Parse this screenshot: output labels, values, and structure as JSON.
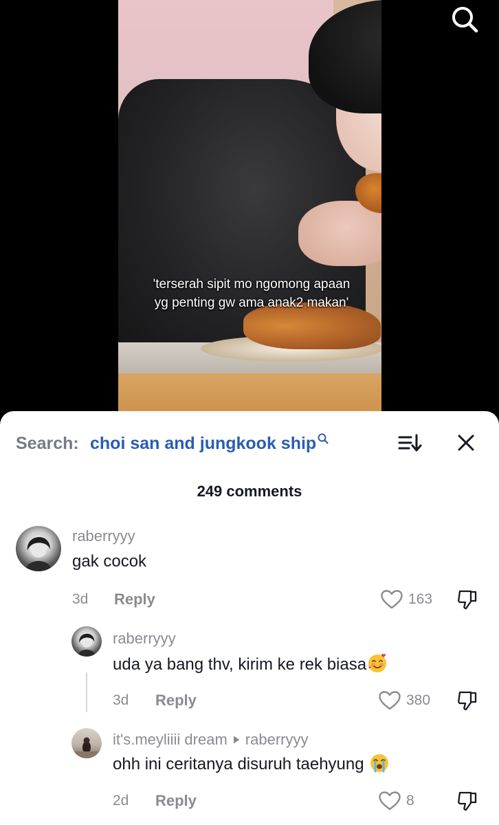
{
  "video": {
    "caption_line1": "'terserah sipit mo ngomong apaan",
    "caption_line2": "yg penting gw ama anak2 makan'"
  },
  "header": {
    "search_label": "Search:",
    "search_query": "choi san and jungkook ship",
    "comments_count": "249 comments"
  },
  "comments": [
    {
      "username": "raberryyy",
      "text": "gak cocok",
      "time": "3d",
      "reply_label": "Reply",
      "likes": "163"
    },
    {
      "username": "raberryyy",
      "text": "uda ya bang thv, kirim ke rek biasa",
      "emoji": "smiling-face-with-hearts",
      "time": "3d",
      "reply_label": "Reply",
      "likes": "380"
    },
    {
      "username": "it's.meyliiii dream",
      "reply_to": "raberryyy",
      "text": "ohh ini ceritanya disuruh taehyung",
      "emoji": "loudly-crying-face",
      "time": "2d",
      "reply_label": "Reply",
      "likes": "8"
    }
  ],
  "colors": {
    "query": "#2a5db0",
    "muted": "#8a8b91",
    "text": "#161823"
  }
}
